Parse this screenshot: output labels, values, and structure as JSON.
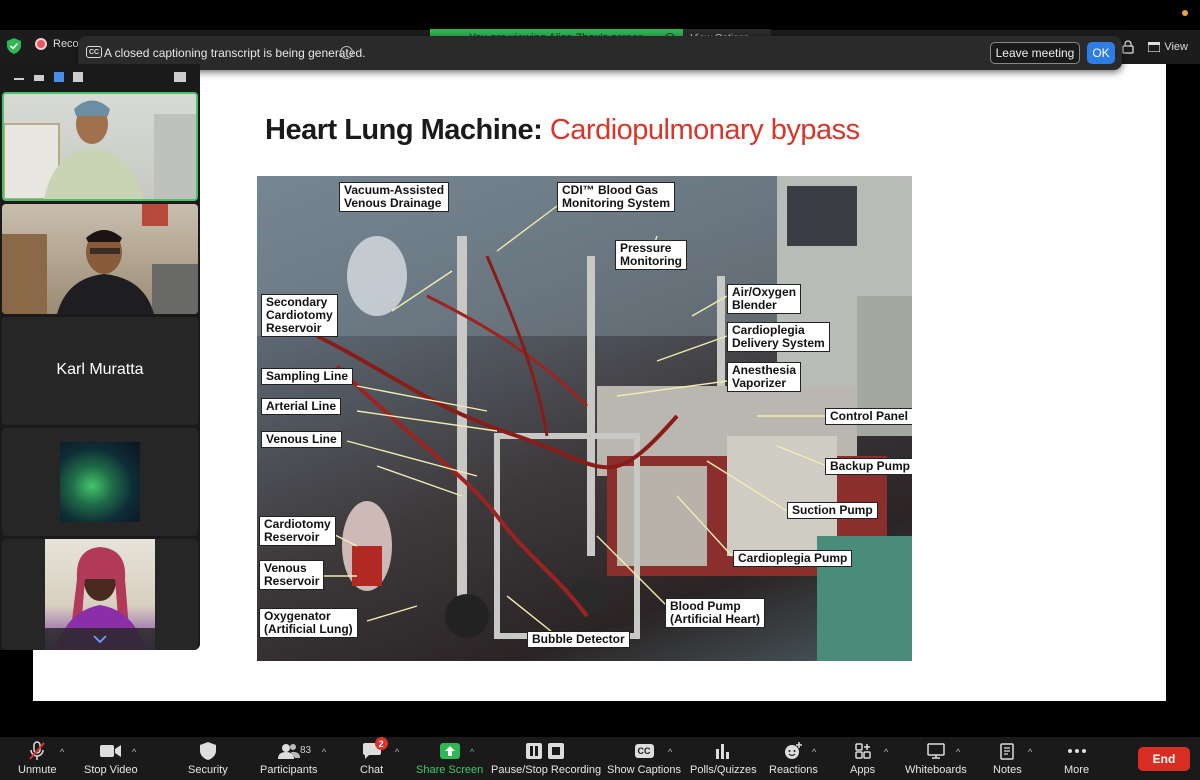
{
  "banner": {
    "viewing_text": "You are viewing Alice Zhou's screen",
    "view_options_label": "View Options"
  },
  "meeting_bar": {
    "recording_label": "Reco",
    "view_label": "View"
  },
  "caption_notice": {
    "cc_badge": "CC",
    "text": "A closed captioning transcript is being generated.",
    "leave_label": "Leave meeting",
    "ok_label": "OK"
  },
  "slide": {
    "title_main": "Heart Lung Machine: ",
    "title_accent": "Cardiopulmonary bypass",
    "labels": {
      "vacuum": "Vacuum-Assisted\nVenous Drainage",
      "cdi": "CDI™ Blood Gas\nMonitoring System",
      "pressure": "Pressure\nMonitoring",
      "air_oxygen": "Air/Oxygen\nBlender",
      "cardioplegia_delivery": "Cardioplegia\nDelivery System",
      "anesthesia": "Anesthesia\nVaporizer",
      "secondary": "Secondary\nCardiotomy\nReservoir",
      "sampling": "Sampling Line",
      "arterial": "Arterial Line",
      "venous_line": "Venous Line",
      "control_panel": "Control Panel",
      "backup_pump": "Backup Pump",
      "suction_pump": "Suction Pump",
      "cardioplegia_pump": "Cardioplegia Pump",
      "cardiotomy": "Cardiotomy\nReservoir",
      "venous_reservoir": "Venous\nReservoir",
      "oxygenator": "Oxygenator\n(Artificial Lung)",
      "blood_pump": "Blood Pump\n(Artificial Heart)",
      "bubble": "Bubble Detector"
    }
  },
  "participants_panel": {
    "tile_name_3": "Karl Muratta"
  },
  "toolbar": {
    "unmute": "Unmute",
    "stop_video": "Stop Video",
    "security": "Security",
    "participants": "Participants",
    "participants_count": "83",
    "chat": "Chat",
    "chat_badge": "2",
    "share_screen": "Share Screen",
    "recording": "Pause/Stop Recording",
    "captions": "Show Captions",
    "captions_icon": "CC",
    "polls": "Polls/Quizzes",
    "reactions": "Reactions",
    "apps": "Apps",
    "whiteboards": "Whiteboards",
    "notes": "Notes",
    "more": "More",
    "end": "End"
  },
  "colors": {
    "accent_green": "#2fb655",
    "end_red": "#d72d23",
    "ok_blue": "#2d7de6",
    "title_red": "#d9362b"
  }
}
